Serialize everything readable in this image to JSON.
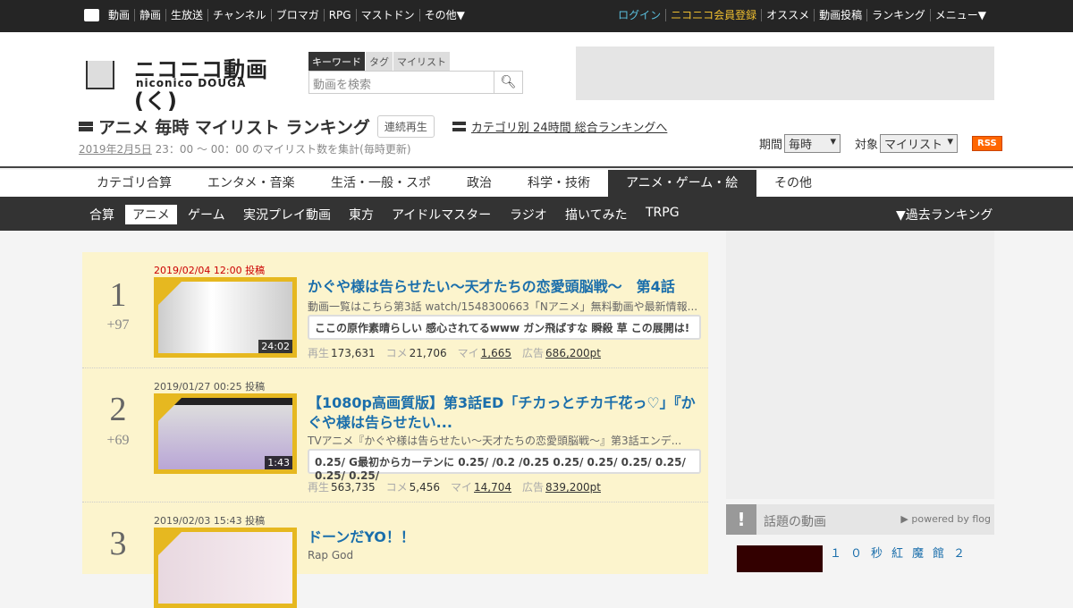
{
  "topbar": {
    "left": [
      "動画",
      "静画",
      "生放送",
      "チャンネル",
      "ブロマガ",
      "RPG",
      "マストドン",
      "その他▼"
    ],
    "right": [
      "ログイン",
      "ニコニコ会員登録",
      "オススメ",
      "動画投稿",
      "ランキング",
      "メニュー▼"
    ]
  },
  "logo": {
    "main": "ニコニコ動画(く)",
    "sub": "niconico DOUGA"
  },
  "search": {
    "tabs": [
      "キーワード",
      "タグ",
      "マイリスト"
    ],
    "placeholder": "動画を検索"
  },
  "page": {
    "title": "アニメ 毎時 マイリスト ランキング",
    "continuous": "連続再生",
    "category_link": "カテゴリ別 24時間 総合ランキングへ",
    "date_link": "2019年2月5日",
    "date_rest": " 23：00 ～ 00：00 のマイリスト数を集計(毎時更新)"
  },
  "filters": {
    "period_label": "期間",
    "period": "毎時",
    "target_label": "対象",
    "target": "マイリスト",
    "rss": "RSS"
  },
  "categories": [
    "カテゴリ合算",
    "エンタメ・音楽",
    "生活・一般・スポ",
    "政治",
    "科学・技術",
    "アニメ・ゲーム・絵",
    "その他"
  ],
  "subnav": [
    "合算",
    "アニメ",
    "ゲーム",
    "実況プレイ動画",
    "東方",
    "アイドルマスター",
    "ラジオ",
    "描いてみた",
    "TRPG"
  ],
  "past": "▼過去ランキング",
  "stat_labels": {
    "play": "再生",
    "comment": "コメ",
    "mylist": "マイ",
    "ad": "広告"
  },
  "ranking": [
    {
      "rank": "1",
      "delta": "+97",
      "date": "2019/02/04 12:00 投稿",
      "duration": "24:02",
      "title": "かぐや様は告らせたい～天才たちの恋愛頭脳戦～　第4話",
      "desc": "動画一覧はこちら第3話 watch/1548300663「Nアニメ」無料動画や最新情報...",
      "comment": "ここの原作素晴らしい 感心されてるwww ガン飛ばすな 瞬殺 草 この展開は!",
      "play": "173,631",
      "comments": "21,706",
      "mylist": "1,665",
      "ad": "686,200pt"
    },
    {
      "rank": "2",
      "delta": "+69",
      "date": "2019/01/27 00:25 投稿",
      "duration": "1:43",
      "title": "【1080p高画質版】第3話ED「チカっとチカ千花っ♡」『かぐや様は告らせたい...",
      "desc": "TVアニメ『かぐや様は告らせたい～天才たちの恋愛頭脳戦～』第3話エンデ...",
      "comment": "0.25/ G最初からカーテンに 0.25/ /0.2 /0.25 0.25/ 0.25/ 0.25/ 0.25/ 0.25/ 0.25/",
      "play": "563,735",
      "comments": "5,456",
      "mylist": "14,704",
      "ad": "839,200pt"
    },
    {
      "rank": "3",
      "date": "2019/02/03 15:43 投稿",
      "title": "ドーンだYO！！",
      "desc": "Rap God"
    }
  ],
  "side": {
    "topic_title": "話題の動画",
    "powered": "▶ powered by flog",
    "item_title": "１０秒紅魔館２"
  }
}
